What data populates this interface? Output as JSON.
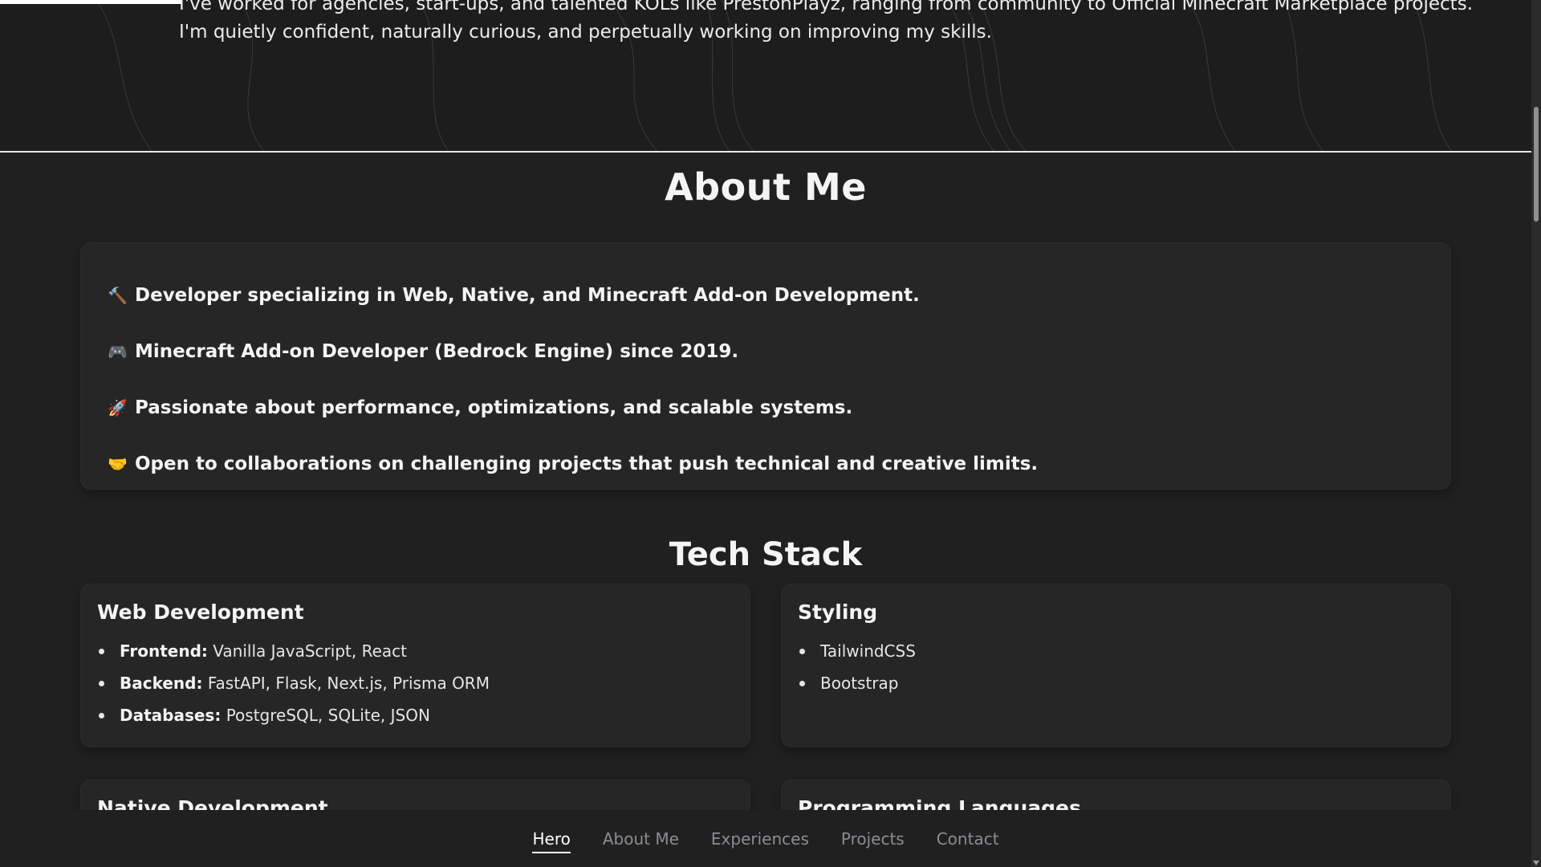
{
  "hero": {
    "line1": "I've worked for agencies, start-ups, and talented KOLs like PrestonPlayz, ranging from community to Official Minecraft Marketplace projects.",
    "line2": "I'm quietly confident, naturally curious, and perpetually working on improving my skills."
  },
  "about": {
    "title": "About Me",
    "items": [
      {
        "icon": "hammer-icon",
        "emoji": "🔨",
        "text": "Developer specializing in Web, Native, and Minecraft Add-on Development."
      },
      {
        "icon": "gamepad-icon",
        "emoji": "🎮",
        "text": "Minecraft Add-on Developer (Bedrock Engine) since 2019."
      },
      {
        "icon": "rocket-icon",
        "emoji": "🚀",
        "text": "Passionate about performance, optimizations, and scalable systems."
      },
      {
        "icon": "handshake-icon",
        "emoji": "🤝",
        "text": "Open to collaborations on challenging projects that push technical and creative limits."
      }
    ]
  },
  "tech": {
    "title": "Tech Stack",
    "web": {
      "title": "Web Development",
      "items": [
        {
          "label": "Frontend:",
          "value": "Vanilla JavaScript, React"
        },
        {
          "label": "Backend:",
          "value": "FastAPI, Flask, Next.js, Prisma ORM"
        },
        {
          "label": "Databases:",
          "value": "PostgreSQL, SQLite, JSON"
        }
      ]
    },
    "styling": {
      "title": "Styling",
      "items": [
        "TailwindCSS",
        "Bootstrap"
      ]
    },
    "native": {
      "title": "Native Development"
    },
    "languages": {
      "title": "Programming Languages"
    }
  },
  "nav": {
    "items": [
      "Hero",
      "About Me",
      "Experiences",
      "Projects",
      "Contact"
    ],
    "active": "Hero"
  },
  "colors": {
    "background": "#202020",
    "card": "#262626",
    "nav_inactive": "#8c8c95",
    "nav_active": "#ffffff"
  }
}
